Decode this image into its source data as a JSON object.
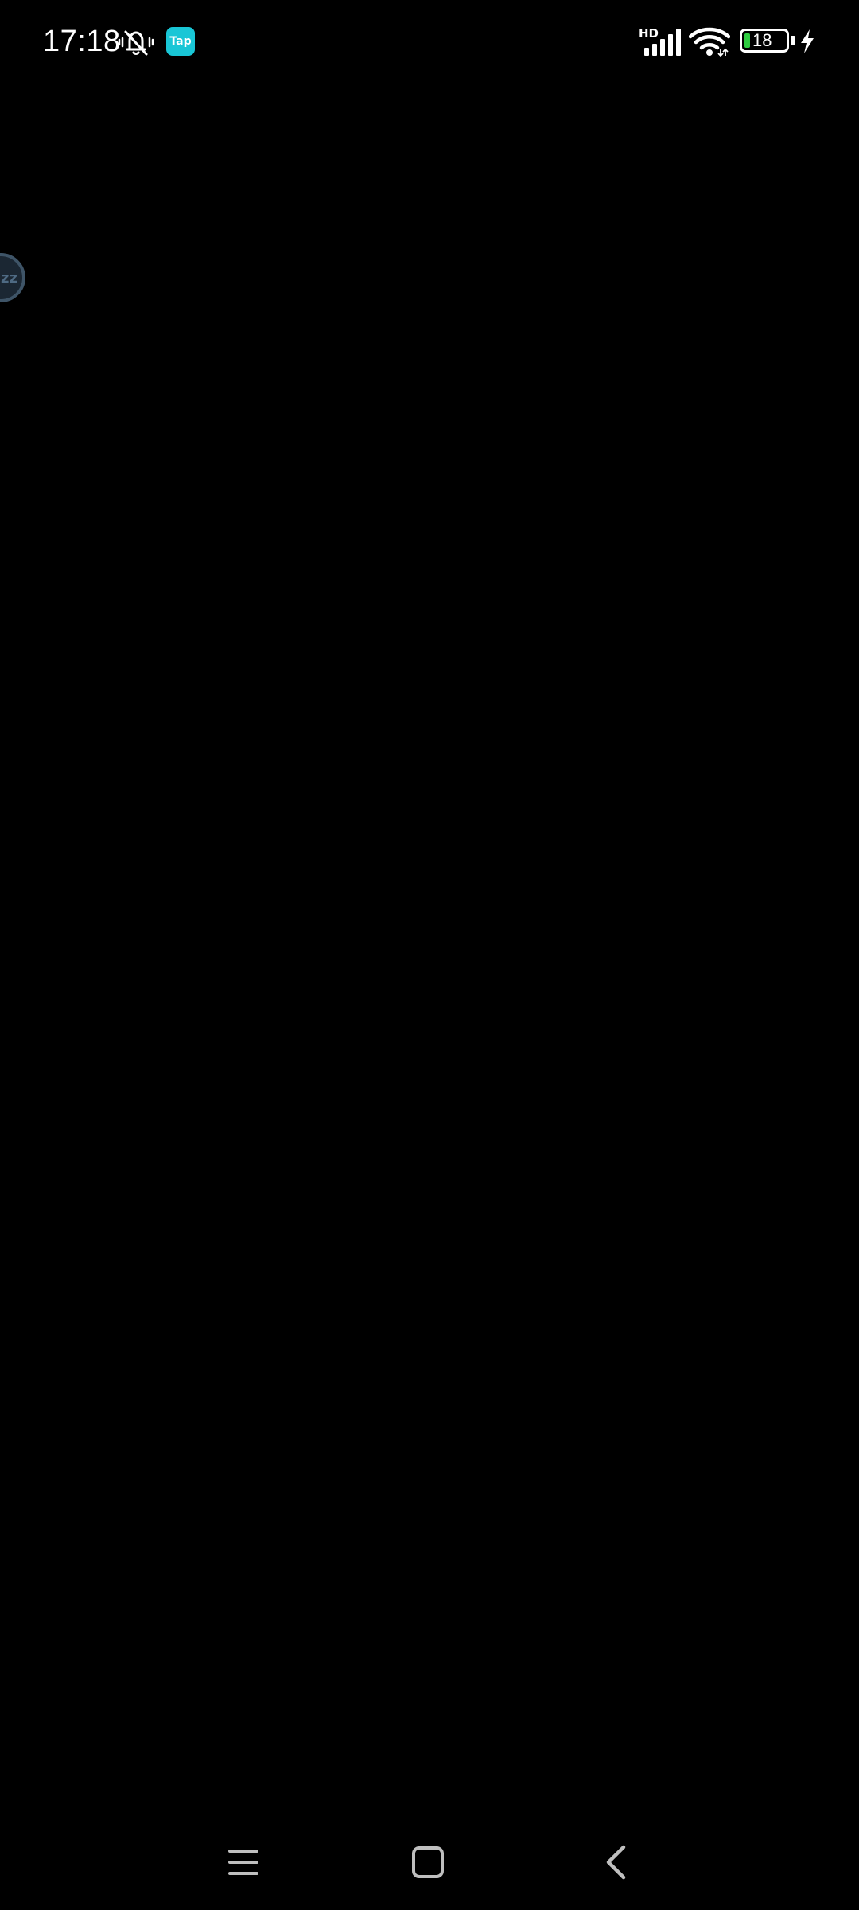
{
  "status_bar": {
    "time": "17:18",
    "mute_icon": "bell-off-vibrate-icon",
    "app_badge": "Tap",
    "network_label": "HD",
    "signal_icon": "cellular-signal-icon",
    "wifi_icon": "wifi-icon",
    "battery_level": "18",
    "charging_icon": "lightning-bolt-icon",
    "colors": {
      "text": "#ffffff",
      "app_badge": "#19c6d6",
      "battery_fill": "#2ecc40"
    }
  },
  "floating_bubble": {
    "label": "zz",
    "colors": {
      "fill": "#1b2733",
      "border": "#3e5467"
    }
  },
  "nav_bar": {
    "menu_icon": "menu-icon",
    "home_icon": "home-square-icon",
    "back_icon": "back-chevron-icon"
  },
  "background_color": "#000000"
}
